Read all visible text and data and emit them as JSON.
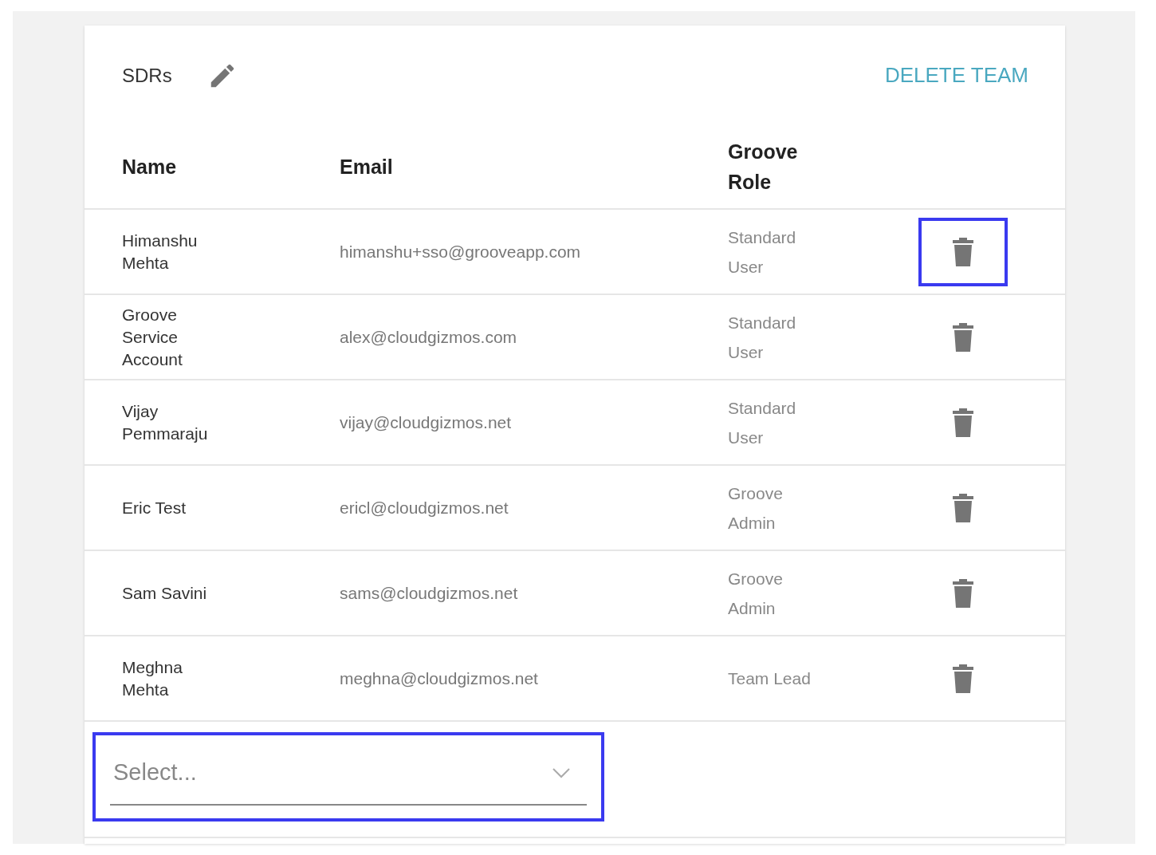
{
  "team": {
    "name": "SDRs",
    "delete_label": "DELETE TEAM"
  },
  "table": {
    "columns": [
      "Name",
      "Email",
      "Groove Role"
    ],
    "rows": [
      {
        "name": "Himanshu Mehta",
        "email": "himanshu+sso@grooveapp.com",
        "role": "Standard User",
        "highlighted": true
      },
      {
        "name": "Groove Service Account",
        "email": "alex@cloudgizmos.com",
        "role": "Standard User",
        "highlighted": false
      },
      {
        "name": "Vijay Pemmaraju",
        "email": "vijay@cloudgizmos.net",
        "role": "Standard User",
        "highlighted": false
      },
      {
        "name": "Eric Test",
        "email": "ericl@cloudgizmos.net",
        "role": "Groove Admin",
        "highlighted": false
      },
      {
        "name": "Sam Savini",
        "email": "sams@cloudgizmos.net",
        "role": "Groove Admin",
        "highlighted": false
      },
      {
        "name": "Meghna Mehta",
        "email": "meghna@cloudgizmos.net",
        "role": "Team Lead",
        "highlighted": false
      }
    ]
  },
  "add_member": {
    "placeholder": "Select...",
    "highlighted": true
  }
}
